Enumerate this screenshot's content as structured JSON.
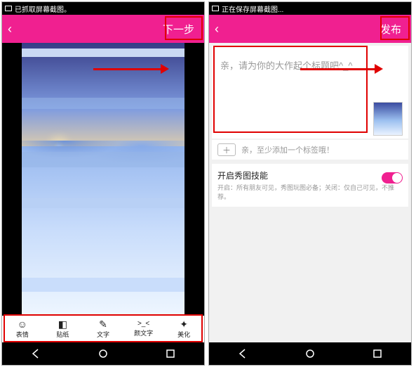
{
  "left": {
    "status": "已抓取屏幕截图。",
    "next_label": "下一步",
    "toolbar": [
      {
        "icon": "☺",
        "label": "表情"
      },
      {
        "icon": "◧",
        "label": "贴纸"
      },
      {
        "icon": "✎",
        "label": "文字"
      },
      {
        "icon": ">_<",
        "label": "颜文字"
      },
      {
        "icon": "✦",
        "label": "美化"
      }
    ]
  },
  "right": {
    "status": "正在保存屏幕截图...",
    "publish_label": "发布",
    "title_placeholder": "亲，请为你的大作起个标题吧^_^",
    "tag_hint": "亲，至少添加一个标签哦！",
    "toggle_title": "开启秀图技能",
    "toggle_sub": "开启：所有朋友可见，秀图玩图必备；关闭：仅自己可见，不推荐。"
  }
}
